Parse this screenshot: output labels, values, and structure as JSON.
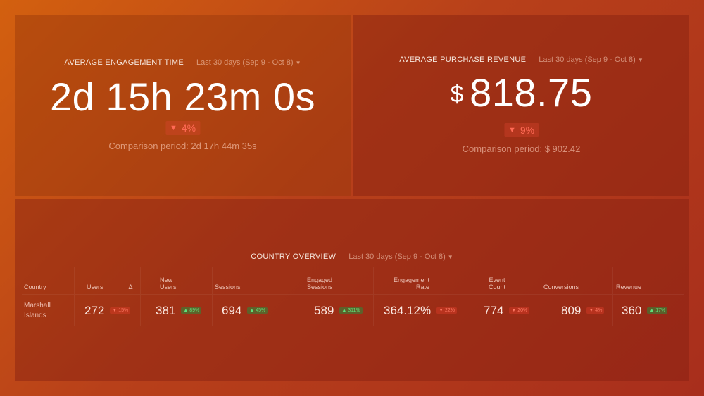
{
  "widgets": {
    "engagement": {
      "title": "AVERAGE ENGAGEMENT TIME",
      "range": "Last 30 days (Sep 9 - Oct 8)",
      "value": "2d 15h 23m 0s",
      "delta": "4%",
      "delta_direction": "down",
      "comparison": "Comparison period: 2d 17h 44m 35s"
    },
    "revenue": {
      "title": "AVERAGE PURCHASE REVENUE",
      "range": "Last 30 days (Sep 9 - Oct 8)",
      "currency": "$",
      "value": "818.75",
      "delta": "9%",
      "delta_direction": "down",
      "comparison": "Comparison period: $ 902.42"
    },
    "country": {
      "title": "COUNTRY OVERVIEW",
      "range": "Last 30 days (Sep 9 - Oct 8)",
      "headers": {
        "country": "Country",
        "users": "Users",
        "delta": "Δ",
        "new_users": [
          "New",
          "Users"
        ],
        "sessions": "Sessions",
        "engaged_sessions": [
          "Engaged",
          "Sessions"
        ],
        "engagement_rate": [
          "Engagement",
          "Rate"
        ],
        "event_count": [
          "Event",
          "Count"
        ],
        "conversions": "Conversions",
        "revenue": "Revenue"
      },
      "row": {
        "country": [
          "Marshall",
          "Islands"
        ],
        "users": "272",
        "users_delta": "15%",
        "new_users": "381",
        "new_users_delta": "89%",
        "sessions": "694",
        "sessions_delta": "45%",
        "engaged_sessions": "589",
        "engaged_sessions_delta": "311%",
        "engagement_rate": "364.12%",
        "engagement_rate_delta": "22%",
        "event_count": "774",
        "event_count_delta": "20%",
        "conversions": "809",
        "conversions_delta": "4%",
        "revenue": "360",
        "revenue_delta": "17%"
      }
    }
  },
  "icons": {
    "down": "▼",
    "up": "▲",
    "chevron": "⌄"
  },
  "colors": {
    "negative": "#ff6a55",
    "positive": "#5fe07a"
  }
}
